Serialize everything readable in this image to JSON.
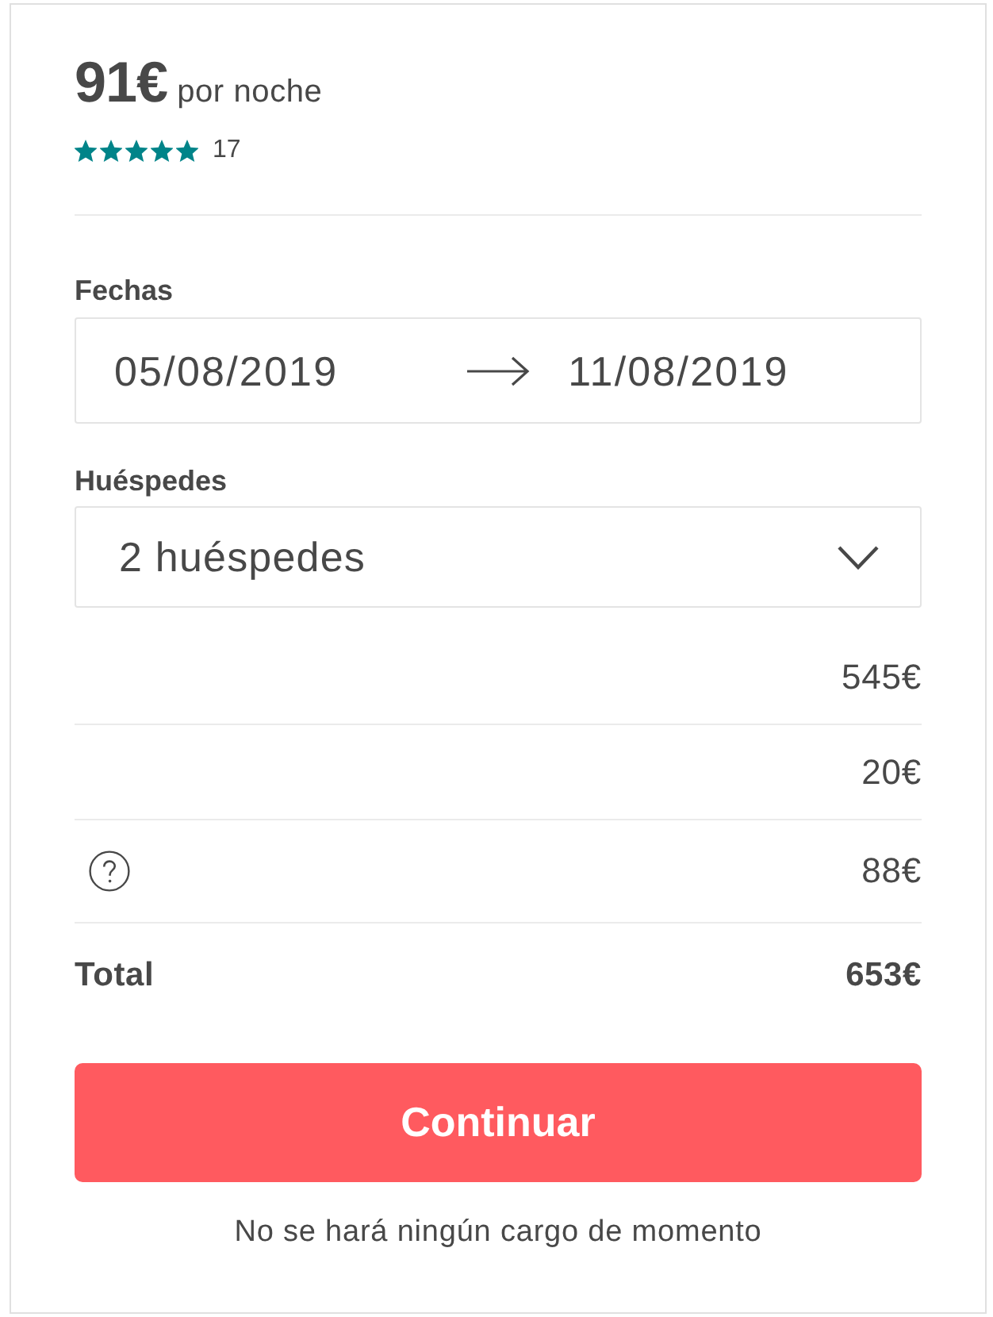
{
  "price": {
    "amount": "91€",
    "unit": "por noche"
  },
  "rating": {
    "stars": 5,
    "count": "17"
  },
  "dates": {
    "label": "Fechas",
    "check_in": "05/08/2019",
    "check_out": "11/08/2019"
  },
  "guests": {
    "label": "Huéspedes",
    "value": "2 huéspedes"
  },
  "price_rows": [
    {
      "kind": "plain",
      "amount": "545€"
    },
    {
      "kind": "plain",
      "amount": "20€"
    },
    {
      "kind": "info",
      "amount": "88€"
    }
  ],
  "total": {
    "label": "Total",
    "amount": "653€"
  },
  "button": {
    "label": "Continuar"
  },
  "note": "No se hará ningún cargo de momento"
}
